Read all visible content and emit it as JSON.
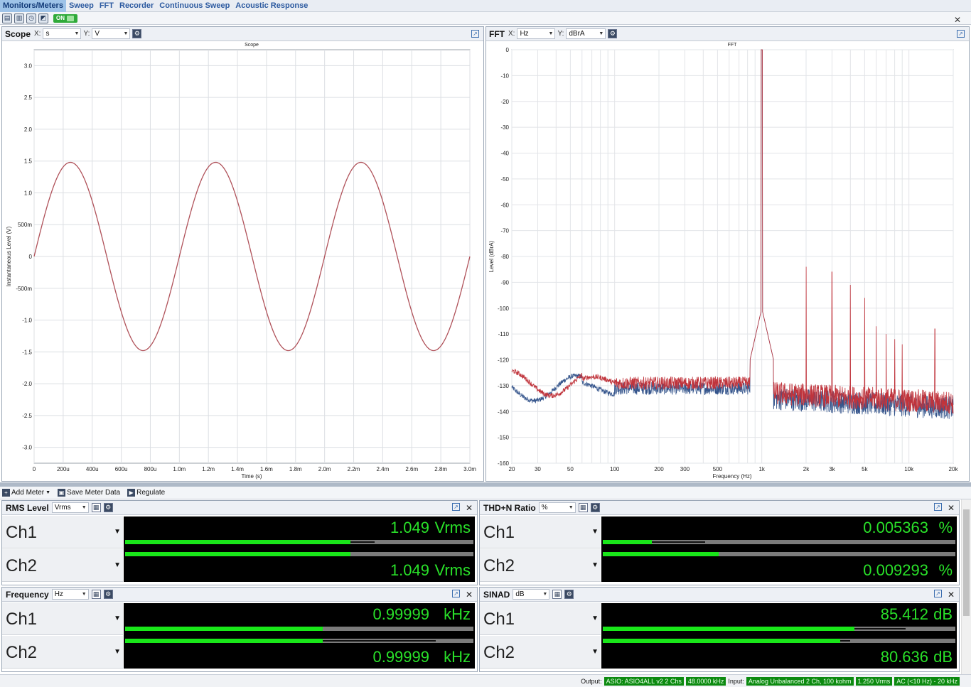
{
  "menu": {
    "tabs": [
      "Monitors/Meters",
      "Sweep",
      "FFT",
      "Recorder",
      "Continuous Sweep",
      "Acoustic Response"
    ],
    "active": 0
  },
  "toolbar": {
    "on_label": "ON",
    "close_glyph": "✕"
  },
  "scope": {
    "title": "Scope",
    "x_label": "X:",
    "x_unit": "s",
    "y_label": "Y:",
    "y_unit": "V",
    "chart_title": "Scope",
    "xlabel": "Time (s)",
    "ylabel": "Instantaneous Level (V)"
  },
  "fft": {
    "title": "FFT",
    "x_label": "X:",
    "x_unit": "Hz",
    "y_label": "Y:",
    "y_unit": "dBrA",
    "chart_title": "FFT",
    "xlabel": "Frequency (Hz)",
    "ylabel": "Level (dBrA)"
  },
  "chart_data": [
    {
      "type": "line",
      "title": "Scope",
      "xlabel": "Time (s)",
      "ylabel": "Instantaneous Level (V)",
      "xlim": [
        0,
        0.003
      ],
      "ylim": [
        -3.25,
        3.25
      ],
      "x_ticks": [
        "0",
        "200u",
        "400u",
        "600u",
        "800u",
        "1.0m",
        "1.2m",
        "1.4m",
        "1.6m",
        "1.8m",
        "2.0m",
        "2.2m",
        "2.4m",
        "2.6m",
        "2.8m",
        "3.0m"
      ],
      "y_ticks": [
        "3.0",
        "2.5",
        "2.0",
        "1.5",
        "1.0",
        "500m",
        "0",
        "-500m",
        "-1.0",
        "-1.5",
        "-2.0",
        "-2.5",
        "-3.0"
      ],
      "y_tick_values": [
        3.0,
        2.5,
        2.0,
        1.5,
        1.0,
        0.5,
        0,
        -0.5,
        -1.0,
        -1.5,
        -2.0,
        -2.5,
        -3.0
      ],
      "grid": true,
      "series": [
        {
          "frequency_hz": 1000,
          "amplitude_v": 1.48,
          "color": "#b0525a"
        }
      ]
    },
    {
      "type": "line",
      "title": "FFT",
      "xlabel": "Frequency (Hz)",
      "ylabel": "Level (dBrA)",
      "xscale": "log",
      "xlim": [
        20,
        20000
      ],
      "ylim": [
        -160,
        0
      ],
      "x_ticks": [
        "20",
        "30",
        "50",
        "100",
        "200",
        "300",
        "500",
        "1k",
        "2k",
        "3k",
        "5k",
        "10k",
        "20k"
      ],
      "x_tick_values": [
        20,
        30,
        50,
        100,
        200,
        300,
        500,
        1000,
        2000,
        3000,
        5000,
        10000,
        20000
      ],
      "y_ticks": [
        "0",
        "-10",
        "-20",
        "-30",
        "-40",
        "-50",
        "-60",
        "-70",
        "-80",
        "-90",
        "-100",
        "-110",
        "-120",
        "-130",
        "-140",
        "-150",
        "-160"
      ],
      "grid": true,
      "series": [
        {
          "channel": "Ch1",
          "color": "#c0343c",
          "fundamental_hz": 1000,
          "fundamental_db": 0,
          "harmonics_hz": [
            2000,
            3000,
            4000,
            5000,
            6000,
            7000,
            8000,
            9000,
            15000
          ],
          "harmonics_db": [
            -84,
            -86,
            -91,
            -96,
            -107,
            -110,
            -112,
            -114,
            -108
          ],
          "floor_db": -129
        },
        {
          "channel": "Ch2",
          "color": "#35558c",
          "fundamental_hz": 1000,
          "fundamental_db": 0,
          "floor_db": -131
        }
      ]
    }
  ],
  "meter_toolbar": {
    "add_meter": "Add Meter",
    "save_data": "Save Meter Data",
    "regulate": "Regulate"
  },
  "meters": [
    {
      "title": "RMS Level",
      "unit": "Vrms",
      "ch": [
        {
          "name": "Ch1",
          "value": "1.049",
          "unit": "Vrms",
          "fill": 0.647,
          "peak": 0.717
        },
        {
          "name": "Ch2",
          "value": "1.049",
          "unit": "Vrms",
          "fill": 0.647,
          "peak": 0.647
        }
      ]
    },
    {
      "title": "THD+N Ratio",
      "unit": "%",
      "ch": [
        {
          "name": "Ch1",
          "value": "0.005363",
          "unit": "%",
          "fill": 0.139,
          "peak": 0.29
        },
        {
          "name": "Ch2",
          "value": "0.009293",
          "unit": "%",
          "fill": 0.329,
          "peak": 0.329
        }
      ]
    },
    {
      "title": "Frequency",
      "unit": "Hz",
      "ch": [
        {
          "name": "Ch1",
          "value": "0.99999",
          "unit": "kHz",
          "fill": 0.568,
          "peak": 0.568
        },
        {
          "name": "Ch2",
          "value": "0.99999",
          "unit": "kHz",
          "fill": 0.568,
          "peak": 0.892
        }
      ]
    },
    {
      "title": "SINAD",
      "unit": "dB",
      "ch": [
        {
          "name": "Ch1",
          "value": "85.412",
          "unit": "dB",
          "fill": 0.714,
          "peak": 0.859
        },
        {
          "name": "Ch2",
          "value": "80.636",
          "unit": "dB",
          "fill": 0.674,
          "peak": 0.702
        }
      ]
    }
  ],
  "status": {
    "output_label": "Output:",
    "output_device": "ASIO: ASIO4ALL v2 2 Chs",
    "output_rate": "48.0000 kHz",
    "input_label": "Input:",
    "input_config": "Analog Unbalanced 2 Ch, 100 kohm",
    "input_range": "1.250 Vrms",
    "input_bw": "AC (<10 Hz) - 20 kHz"
  },
  "colors": {
    "meter_green": "#29e029",
    "bar_fill": "#19e619",
    "scope_trace": "#b0525a"
  }
}
